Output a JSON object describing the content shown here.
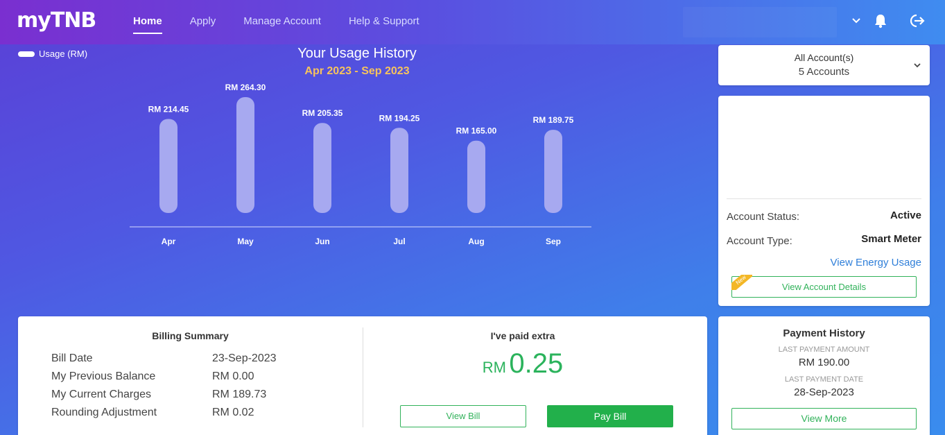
{
  "header": {
    "logo": "myTNB",
    "nav": [
      {
        "label": "Home",
        "active": true
      },
      {
        "label": "Apply",
        "active": false
      },
      {
        "label": "Manage Account",
        "active": false
      },
      {
        "label": "Help & Support",
        "active": false
      }
    ],
    "icons": [
      "chevron-down-icon",
      "bell-icon",
      "logout-icon"
    ]
  },
  "chart": {
    "legend": "Usage (RM)",
    "title": "Your Usage History",
    "subtitle": "Apr 2023 - Sep 2023"
  },
  "chart_data": {
    "type": "bar",
    "categories": [
      "Apr",
      "May",
      "Jun",
      "Jul",
      "Aug",
      "Sep"
    ],
    "values": [
      214.45,
      264.3,
      205.35,
      194.25,
      165.0,
      189.75
    ],
    "value_labels": [
      "RM 214.45",
      "RM 264.30",
      "RM 205.35",
      "RM 194.25",
      "RM 165.00",
      "RM 189.75"
    ],
    "title": "Your Usage History",
    "subtitle": "Apr 2023 - Sep 2023",
    "series": [
      {
        "name": "Usage (RM)",
        "values": [
          214.45,
          264.3,
          205.35,
          194.25,
          165.0,
          189.75
        ]
      }
    ],
    "grid": false,
    "legend_position": "top-left"
  },
  "account_selector": {
    "title": "All Account(s)",
    "count": "5 Accounts"
  },
  "account_card": {
    "status_label": "Account Status:",
    "status_value": "Active",
    "type_label": "Account Type:",
    "type_value": "Smart Meter",
    "energy_link": "View Energy Usage",
    "new_badge": "New",
    "details_button": "View Account Details"
  },
  "billing": {
    "title": "Billing Summary",
    "rows": [
      {
        "label": "Bill Date",
        "value": "23-Sep-2023"
      },
      {
        "label": "My Previous Balance",
        "value": "RM 0.00"
      },
      {
        "label": "My Current Charges",
        "value": "RM 189.73"
      },
      {
        "label": "Rounding Adjustment",
        "value": "RM 0.02"
      }
    ],
    "paid_title": "I've paid extra",
    "paid_currency": "RM",
    "paid_amount": "0.25",
    "view_bill": "View Bill",
    "pay_bill": "Pay Bill"
  },
  "payment_history": {
    "title": "Payment History",
    "last_amount_label": "LAST PAYMENT AMOUNT",
    "last_amount_value": "RM 190.00",
    "last_date_label": "LAST PAYMENT DATE",
    "last_date_value": "28-Sep-2023",
    "view_more": "View More"
  },
  "colors": {
    "accent_green": "#22b04b",
    "link_blue": "#2f7fd9",
    "subtitle_orange": "#f7c35c",
    "bar_fill": "#a7a9f0"
  }
}
